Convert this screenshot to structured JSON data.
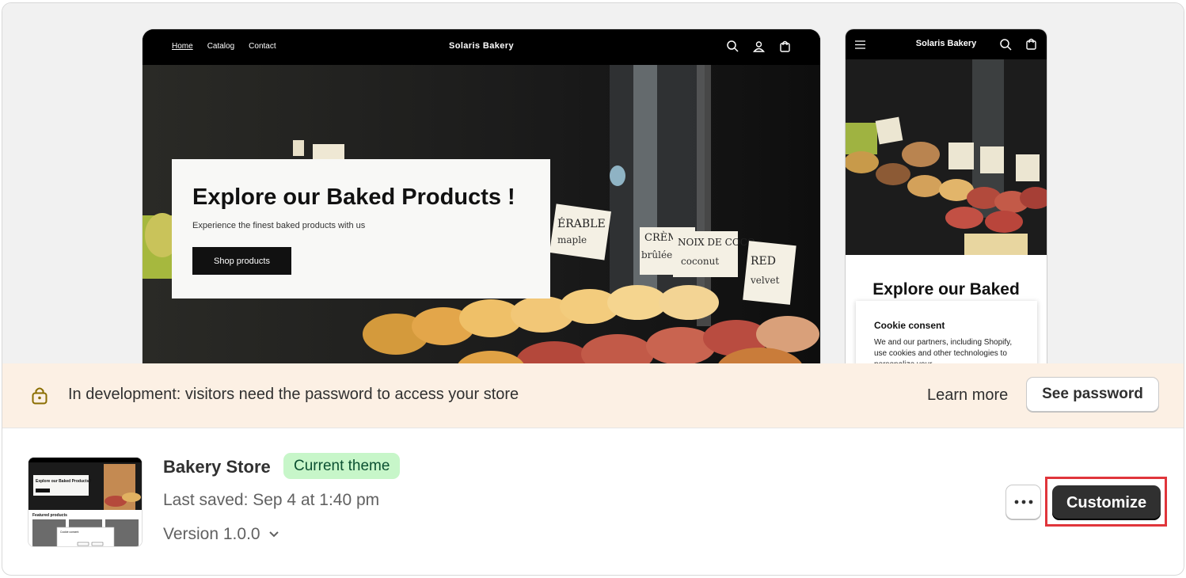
{
  "desktop_preview": {
    "nav_links": [
      "Home",
      "Catalog",
      "Contact"
    ],
    "brand": "Solaris Bakery",
    "hero_title": "Explore our Baked Products !",
    "hero_subtitle": "Experience the finest baked products with us",
    "hero_button": "Shop products",
    "price_tags": [
      "ÉRABLE",
      "maple",
      "CRÈME",
      "brûlée",
      "NOIX DE COCO",
      "coconut",
      "RED",
      "velvet"
    ]
  },
  "mobile_preview": {
    "brand": "Solaris Bakery",
    "hero_title": "Explore our Baked",
    "cookie_title": "Cookie consent",
    "cookie_text": "We and our partners, including Shopify, use cookies and other technologies to personalize your"
  },
  "banner": {
    "message": "In development: visitors need the password to access your store",
    "learn_more": "Learn more",
    "see_password": "See password"
  },
  "theme": {
    "name": "Bakery Store",
    "badge": "Current theme",
    "last_saved": "Last saved: Sep 4 at 1:40 pm",
    "version": "Version 1.0.0",
    "customize": "Customize",
    "thumb_title": "Explore our Baked Products !",
    "thumb_section": "Featured products",
    "thumb_cookie": "Cookie consent"
  },
  "colors": {
    "banner_bg": "#fcf0e4",
    "badge_bg": "#c7f6c9",
    "primary_btn": "#303030",
    "highlight": "#e0353b"
  }
}
